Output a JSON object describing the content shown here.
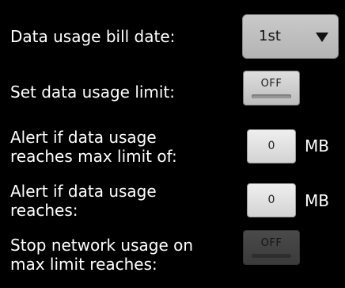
{
  "bill_date": {
    "label": "Data usage bill date:",
    "selected": "1st"
  },
  "data_limit": {
    "label": "Set data usage limit:",
    "toggle": "OFF"
  },
  "max_alert": {
    "label": "Alert if data usage\nreaches max limit of:",
    "value": "0",
    "unit": "MB"
  },
  "usage_alert": {
    "label": "Alert if data usage\nreaches:",
    "value": "0",
    "unit": "MB"
  },
  "stop_network": {
    "label": "Stop network usage on\nmax limit reaches:",
    "toggle": "OFF"
  }
}
